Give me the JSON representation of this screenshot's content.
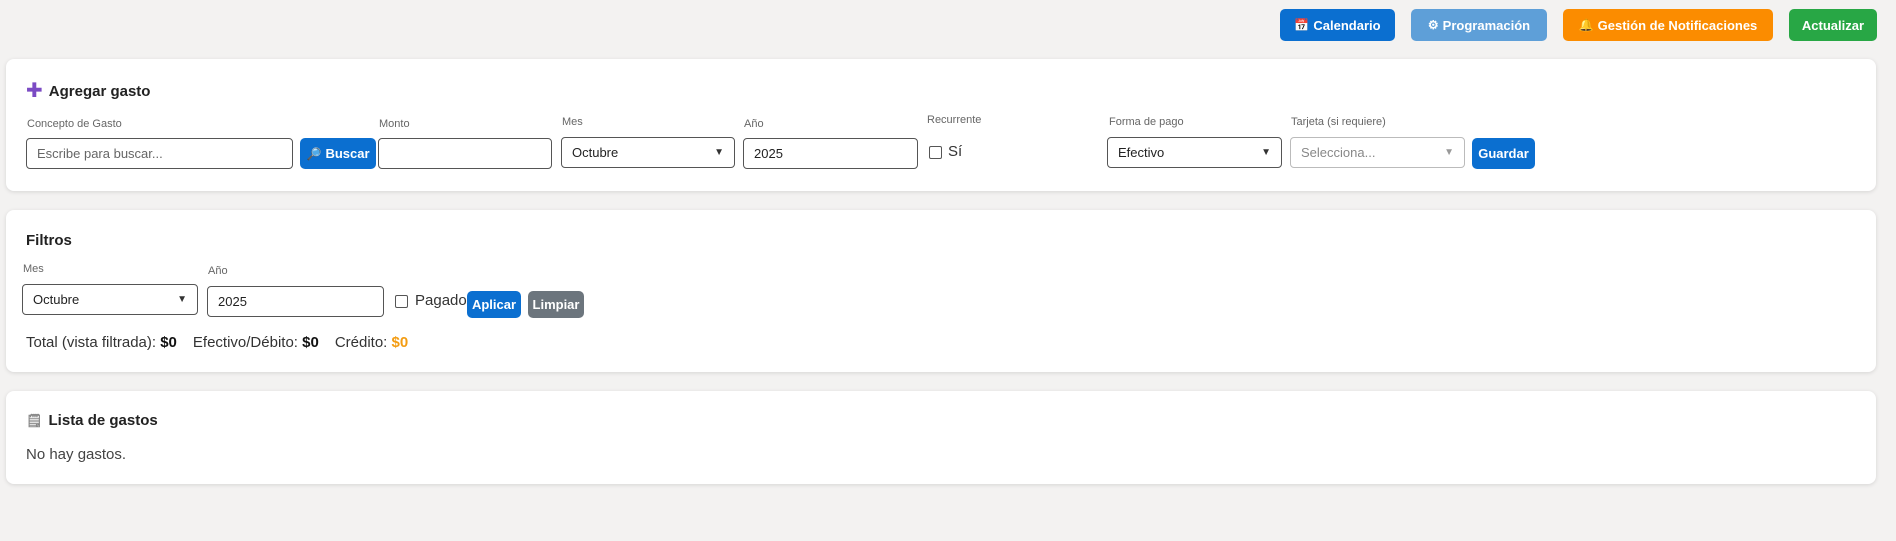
{
  "topbar": {
    "calendar_label": "Calendario",
    "programming_label": "Programación",
    "notifications_label": "Gestión de Notificaciones",
    "update_label": "Actualizar"
  },
  "add_expense": {
    "title": "Agregar gasto",
    "concept_label": "Concepto de Gasto",
    "concept_placeholder": "Escribe para buscar...",
    "search_label": "Buscar",
    "amount_label": "Monto",
    "amount_value": "",
    "month_label": "Mes",
    "month_value": "Octubre",
    "year_label": "Año",
    "year_value": "2025",
    "recurrent_label": "Recurrente",
    "recurrent_check_label": "Sí",
    "payment_label": "Forma de pago",
    "payment_value": "Efectivo",
    "card_label": "Tarjeta (si requiere)",
    "card_placeholder": "Selecciona...",
    "save_label": "Guardar"
  },
  "filters": {
    "title": "Filtros",
    "month_label": "Mes",
    "month_value": "Octubre",
    "year_label": "Año",
    "year_value": "2025",
    "paid_label": "Pagado",
    "apply_label": "Aplicar",
    "clear_label": "Limpiar",
    "total_label": "Total (vista filtrada):",
    "total_value": "$0",
    "cash_label": "Efectivo/Débito:",
    "cash_value": "$0",
    "credit_label": "Crédito:",
    "credit_value": "$0"
  },
  "list": {
    "title": "Lista de gastos",
    "empty_text": "No hay gastos."
  },
  "colors": {
    "primary": "#0b6fd0",
    "secondary": "#5e9fd8",
    "warning": "#fb8c00",
    "success": "#28a745",
    "muted": "#6c757d",
    "credit": "#f39c12"
  },
  "icons": [
    "calendar-icon",
    "gear-icon",
    "bell-icon",
    "plus-icon",
    "magnifier-icon",
    "notepad-icon"
  ]
}
